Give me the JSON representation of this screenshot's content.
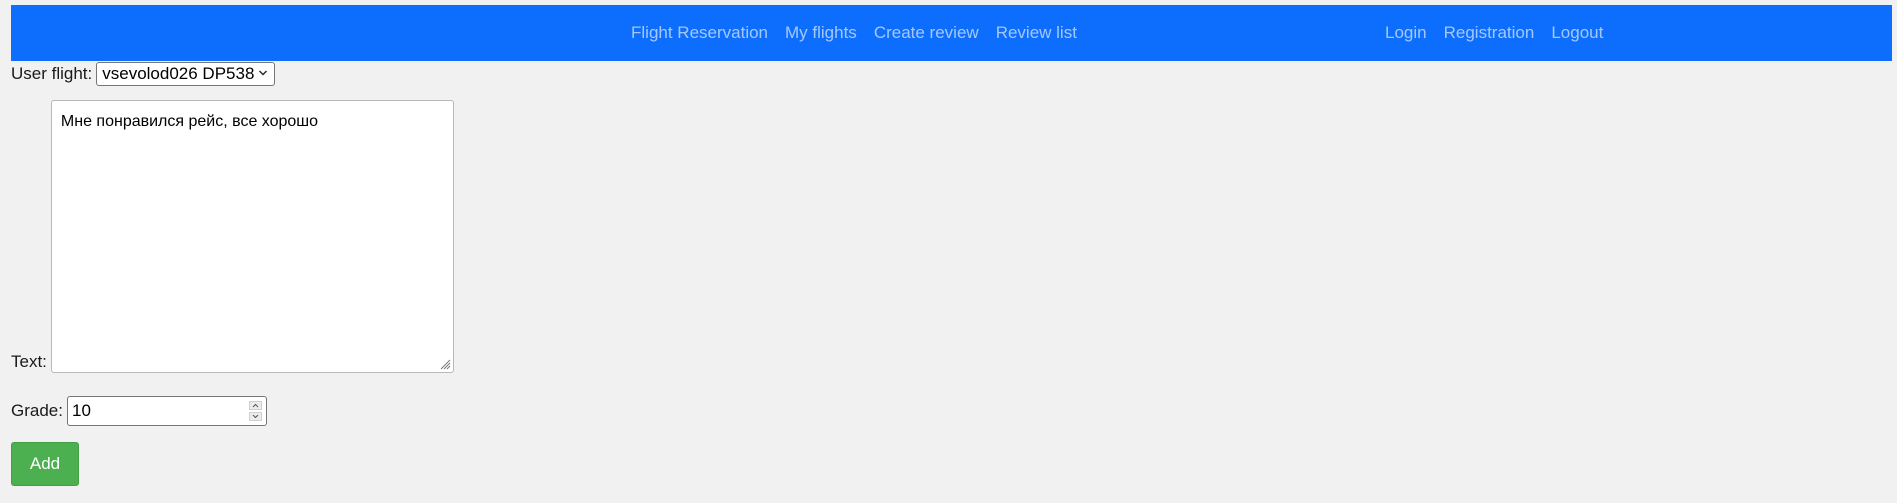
{
  "nav": {
    "main_links": [
      {
        "label": "Flight Reservation"
      },
      {
        "label": "My flights"
      },
      {
        "label": "Create review"
      },
      {
        "label": "Review list"
      }
    ],
    "auth_links": [
      {
        "label": "Login"
      },
      {
        "label": "Registration"
      },
      {
        "label": "Logout"
      }
    ],
    "background_color": "#0d6efd"
  },
  "form": {
    "flight_label": "User flight:",
    "flight_selected": "vsevolod026 DP538",
    "text_label": "Text:",
    "text_value": "Мне понравился рейс, все хорошо",
    "grade_label": "Grade:",
    "grade_value": "10",
    "submit_label": "Add",
    "submit_color": "#4caf50"
  },
  "icons": {
    "select": "chevron-down-icon",
    "textarea": "resize-grip-icon",
    "spinner_up": "spinner-up-icon",
    "spinner_down": "spinner-down-icon"
  }
}
